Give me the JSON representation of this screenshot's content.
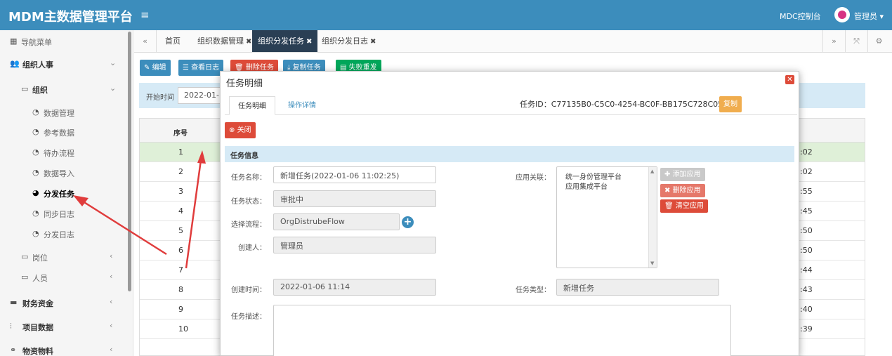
{
  "header": {
    "brand": "MDM主数据管理平台",
    "menu_icon": "hamburger-icon",
    "mdc_label": "MDC控制台",
    "admin_label": "管理员 ▾"
  },
  "sidebar": {
    "nav_title": "导航菜单",
    "items": [
      {
        "label": "组织人事"
      },
      {
        "label": "组织"
      },
      {
        "label": "数据管理"
      },
      {
        "label": "参考数据"
      },
      {
        "label": "待办流程"
      },
      {
        "label": "数据导入"
      },
      {
        "label": "分发任务"
      },
      {
        "label": "同步日志"
      },
      {
        "label": "分发日志"
      },
      {
        "label": "岗位"
      },
      {
        "label": "人员"
      },
      {
        "label": "财务资金"
      },
      {
        "label": "项目数据"
      },
      {
        "label": "物资物料"
      }
    ]
  },
  "tabs": {
    "items": [
      {
        "label": "首页"
      },
      {
        "label": "组织数据管理"
      },
      {
        "label": "组织分发任务"
      },
      {
        "label": "组织分发日志"
      }
    ]
  },
  "toolbar": {
    "edit": "编辑",
    "view_log": "查看日志",
    "delete_task": "删除任务",
    "copy_task": "复制任务",
    "resend": "失败重发"
  },
  "filter": {
    "start_time_label": "开始时间",
    "start_time_value": "2022-01-"
  },
  "table": {
    "header_seq": "序号",
    "rows": [
      {
        "n": "1",
        "t": ":02"
      },
      {
        "n": "2",
        "t": ":02"
      },
      {
        "n": "3",
        "t": ":55"
      },
      {
        "n": "4",
        "t": ":45"
      },
      {
        "n": "5",
        "t": ":50"
      },
      {
        "n": "6",
        "t": ":50"
      },
      {
        "n": "7",
        "t": ":44"
      },
      {
        "n": "8",
        "t": ":43"
      },
      {
        "n": "9",
        "t": ":40"
      },
      {
        "n": "10",
        "t": ":39"
      }
    ]
  },
  "modal": {
    "title": "任务明细",
    "tab_detail": "任务明细",
    "tab_ops": "操作详情",
    "task_id": "任务ID：C77135B0-C5C0-4254-BC0F-BB175C728C05",
    "copy_btn": "复制",
    "close_btn": "关闭",
    "section_title": "任务信息",
    "fields": {
      "name_label": "任务名称：",
      "name_value": "新增任务(2022-01-06 11:02:25)",
      "status_label": "任务状态：",
      "status_value": "审批中",
      "flow_label": "选择流程：",
      "flow_value": "OrgDistrubeFlow",
      "creator_label": "创建人：",
      "creator_value": "管理员",
      "created_label": "创建时间：",
      "created_value": "2022-01-06 11:14",
      "type_label": "任务类型：",
      "type_value": "新增任务",
      "desc_label": "任务描述：",
      "apps_label": "应用关联："
    },
    "apps": [
      "统一身份管理平台",
      "应用集成平台"
    ],
    "add_app": "添加应用",
    "del_app": "删除应用",
    "clear_app": "清空应用"
  },
  "colors": {
    "header_bg": "#3c8dbc",
    "active_tab": "#2a3f54",
    "danger": "#dd4b39",
    "success": "#00a65a",
    "warning": "#f0ad4e",
    "annotation_arrow": "#e03c3c"
  }
}
